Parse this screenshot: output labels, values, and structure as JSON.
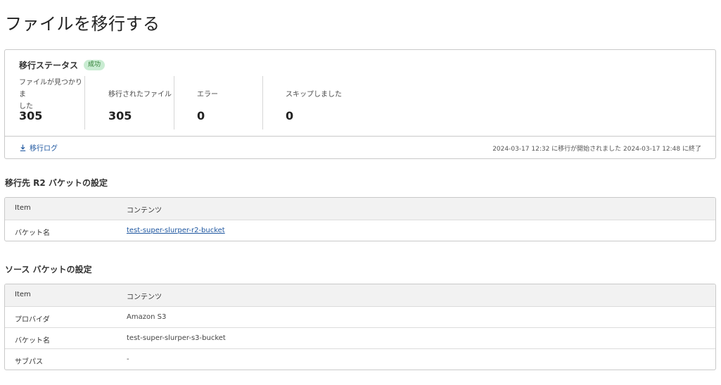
{
  "page": {
    "title": "ファイルを移行する"
  },
  "status": {
    "title": "移行ステータス",
    "badge": "成功",
    "badge_color": "#c9ecd2",
    "stats": [
      {
        "label_line1": "ファイルが見つかりま",
        "label_line2": "した",
        "value": "305"
      },
      {
        "label_line1": "移行されたファイル",
        "value": "305"
      },
      {
        "label_line1": "エラー",
        "value": "0"
      },
      {
        "label_line1": "スキップしました",
        "value": "0"
      }
    ],
    "log_link": "移行ログ",
    "time_range": "2024-03-17 12:32 に移行が開始されました 2024-03-17 12:48 に終了"
  },
  "dest": {
    "title": "移行先 R2 バケットの設定",
    "header": {
      "key": "Item",
      "value": "コンテンツ"
    },
    "rows": [
      {
        "key": "バケット名",
        "value": "test-super-slurper-r2-bucket"
      }
    ]
  },
  "source": {
    "title": "ソース バケットの設定",
    "header": {
      "key": "Item",
      "value": "コンテンツ"
    },
    "rows": [
      {
        "key": "プロバイダ",
        "value": "Amazon S3"
      },
      {
        "key": "バケット名",
        "value": "test-super-slurper-s3-bucket"
      },
      {
        "key": "サブパス",
        "value": "-"
      }
    ]
  },
  "colors": {
    "link": "#1f57a0",
    "border": "#c9c9c9",
    "header_bg": "#f2f2f2"
  }
}
